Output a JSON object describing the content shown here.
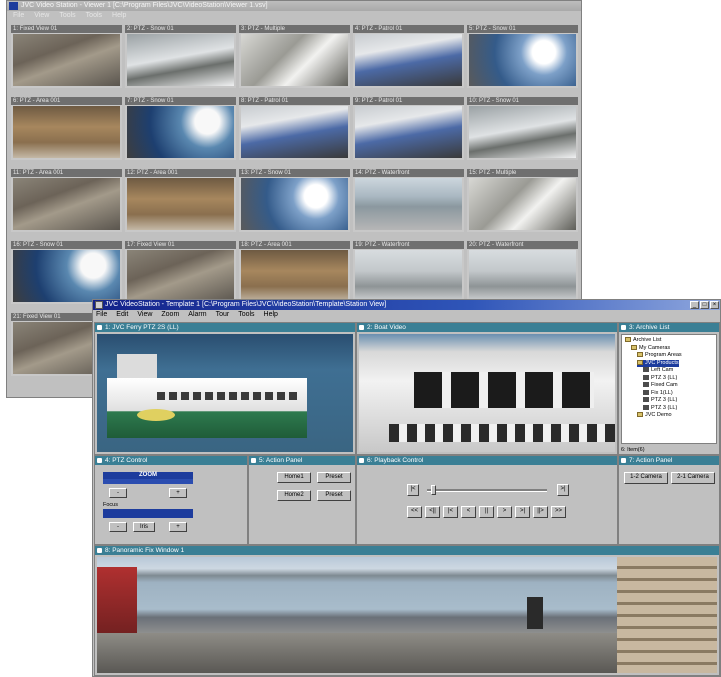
{
  "back_window": {
    "title": "JVC Video Station - Viewer 1 [C:\\Program Files\\JVC\\VideoStation\\Viewer 1.vsv]",
    "menu": [
      "File",
      "View",
      "Tools",
      "Tools",
      "Help"
    ],
    "cameras": [
      {
        "label": "1: Fixed View 01",
        "scene": "office"
      },
      {
        "label": "2: PTZ - Snow 01",
        "scene": "road"
      },
      {
        "label": "3: PTZ - Multiple",
        "scene": "multi"
      },
      {
        "label": "4: PTZ - Patrol 01",
        "scene": "desk"
      },
      {
        "label": "5: PTZ - Snow 01",
        "scene": "face"
      },
      {
        "label": "6: PTZ - Area 001",
        "scene": "boxes"
      },
      {
        "label": "7: PTZ - Snow 01",
        "scene": "face2"
      },
      {
        "label": "8: PTZ - Patrol 01",
        "scene": "desk"
      },
      {
        "label": "9: PTZ - Patrol 01",
        "scene": "desk"
      },
      {
        "label": "10: PTZ - Snow 01",
        "scene": "road"
      },
      {
        "label": "11: PTZ - Area 001",
        "scene": "office"
      },
      {
        "label": "12: PTZ - Area 001",
        "scene": "boxes"
      },
      {
        "label": "13: PTZ - Snow 01",
        "scene": "face"
      },
      {
        "label": "14: PTZ - Waterfront",
        "scene": "harbor"
      },
      {
        "label": "15: PTZ - Multiple",
        "scene": "multi"
      },
      {
        "label": "16: PTZ - Snow 01",
        "scene": "face2"
      },
      {
        "label": "17: Fixed View 01",
        "scene": "office"
      },
      {
        "label": "18: PTZ - Area 001",
        "scene": "boxes"
      },
      {
        "label": "19: PTZ - Waterfront",
        "scene": "rain"
      },
      {
        "label": "20: PTZ - Waterfront",
        "scene": "rain"
      },
      {
        "label": "21: Fixed View 01",
        "scene": "office"
      }
    ]
  },
  "front_window": {
    "title": "JVC VideoStation - Template 1 [C:\\Program Files\\JVC\\VideoStation\\Template\\Station View]",
    "menu": [
      "File",
      "Edit",
      "View",
      "Zoom",
      "Alarm",
      "Tour",
      "Tools",
      "Help"
    ],
    "panels": {
      "ferry": "1: JVC Ferry PTZ 2S (LL)",
      "boat": "2: Boat Video",
      "archive": "3: Archive List",
      "ptz": "4: PTZ Control",
      "action": "5: Action Panel",
      "playback": "6: Playback Control",
      "action2": "7: Action Panel",
      "pano": "8: Panoramic Fix Window 1"
    },
    "archive_tree": [
      {
        "text": "Archive List",
        "indent": 0,
        "icon": "folder"
      },
      {
        "text": "My Cameras",
        "indent": 1,
        "icon": "folder"
      },
      {
        "text": "Program Areas",
        "indent": 2,
        "icon": "folder"
      },
      {
        "text": "JVC Products",
        "indent": 2,
        "icon": "folder",
        "selected": true
      },
      {
        "text": "Left Cam",
        "indent": 3,
        "icon": "cam"
      },
      {
        "text": "PTZ 3 (LL)",
        "indent": 3,
        "icon": "cam"
      },
      {
        "text": "Fixed Cam",
        "indent": 3,
        "icon": "cam"
      },
      {
        "text": "Fix 1(LL)",
        "indent": 3,
        "icon": "cam"
      },
      {
        "text": "PTZ 3 (LL)",
        "indent": 3,
        "icon": "cam"
      },
      {
        "text": "PTZ 3 (LL)",
        "indent": 3,
        "icon": "cam"
      },
      {
        "text": "JVC Demo",
        "indent": 2,
        "icon": "folder"
      }
    ],
    "archive_status": "6: Item(6)",
    "ptz": {
      "zoom_label": "ZOOM",
      "focus_label": "Focus",
      "iris_label": "Iris"
    },
    "action_buttons": [
      "Home1",
      "Preset",
      "Home2",
      "Preset"
    ],
    "action2_buttons": [
      "1-2 Camera",
      "2-1 Camera"
    ],
    "playback_buttons": [
      "<<",
      "<||",
      "|<",
      "<",
      "||",
      ">",
      ">|",
      "||>",
      ">>"
    ]
  }
}
